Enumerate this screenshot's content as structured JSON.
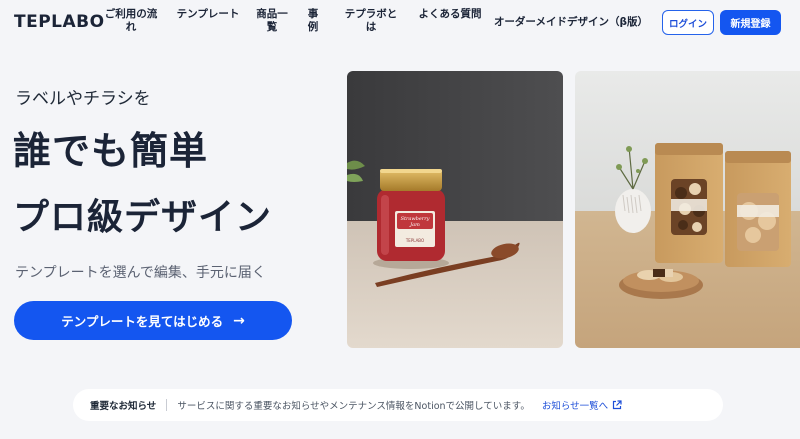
{
  "brand": {
    "logo": "TEPLABO"
  },
  "nav": {
    "items": [
      {
        "label": "ご利用の流れ"
      },
      {
        "label": "テンプレート"
      },
      {
        "label": "商品一覧"
      },
      {
        "label": "事例"
      },
      {
        "label": "テプラボとは"
      },
      {
        "label": "よくある質問"
      },
      {
        "label": "オーダーメイドデザイン（β版）"
      }
    ],
    "login_label": "ログイン",
    "signup_label": "新規登録"
  },
  "hero": {
    "subtitle": "ラベルやチラシを",
    "title_line1": "誰でも簡単",
    "title_line2": "プロ級デザイン",
    "description": "テンプレートを選んで編集、手元に届く",
    "cta_label": "テンプレートを見てはじめる",
    "cta_icon": "arrow-right-icon"
  },
  "images": {
    "jam_label_line1": "Strawberry",
    "jam_label_line2": "Jam",
    "jam_label_brand": "TEPLABO"
  },
  "notice": {
    "label": "重要なお知らせ",
    "text": "サービスに関する重要なお知らせやメンテナンス情報をNotionで公開しています。",
    "link_label": "お知らせ一覧へ",
    "link_icon": "external-link-icon"
  },
  "colors": {
    "accent": "#1456f0",
    "text_dark": "#1b2437",
    "background": "#f4f5f8"
  }
}
